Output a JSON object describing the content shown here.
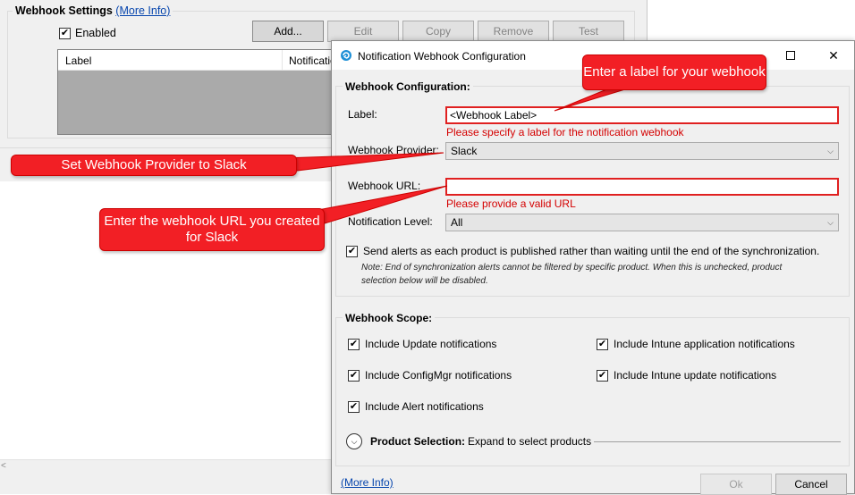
{
  "background_window": {
    "section_title": "Webhook Settings",
    "more_info": "(More Info)",
    "enabled_label": "Enabled",
    "enabled_checked": true,
    "buttons": [
      "Add...",
      "Edit",
      "Copy",
      "Remove",
      "Test"
    ],
    "list_columns": [
      "Label",
      "Notificatio"
    ]
  },
  "dialog": {
    "title": "Notification Webhook Configuration",
    "config_group_title": "Webhook Configuration:",
    "label_field": {
      "label": "Label:",
      "value": "<Webhook Label>",
      "error": "Please specify a label for the notification webhook"
    },
    "provider_field": {
      "label": "Webhook Provider:",
      "value": "Slack"
    },
    "url_field": {
      "label": "Webhook URL:",
      "value": "",
      "error": "Please provide a valid URL"
    },
    "level_field": {
      "label": "Notification Level:",
      "value": "All"
    },
    "send_alerts": {
      "label": "Send alerts as each product is published rather than waiting until the end of the synchronization.",
      "checked": true,
      "note_line1": "Note: End of synchronization alerts cannot be filtered by specific product. When this is unchecked, product",
      "note_line2": "selection below will be disabled."
    },
    "scope_group_title": "Webhook Scope:",
    "scope_items": [
      {
        "label": "Include Update notifications",
        "checked": true
      },
      {
        "label": "Include Intune application notifications",
        "checked": true
      },
      {
        "label": "Include ConfigMgr notifications",
        "checked": true
      },
      {
        "label": "Include Intune update notifications",
        "checked": true
      },
      {
        "label": "Include Alert notifications",
        "checked": true
      }
    ],
    "product_selection": {
      "label": "Product Selection:",
      "hint": "Expand to select products"
    },
    "more_info": "(More Info)",
    "ok_label": "Ok",
    "cancel_label": "Cancel"
  },
  "callouts": {
    "label_hint": "Enter a label for your webhook",
    "provider_hint": "Set Webhook Provider to Slack",
    "url_hint": "Enter the webhook URL you created for Slack"
  },
  "colors": {
    "callout_red": "#f21f25",
    "error_red": "#d40000",
    "link_blue": "#0645ad"
  }
}
